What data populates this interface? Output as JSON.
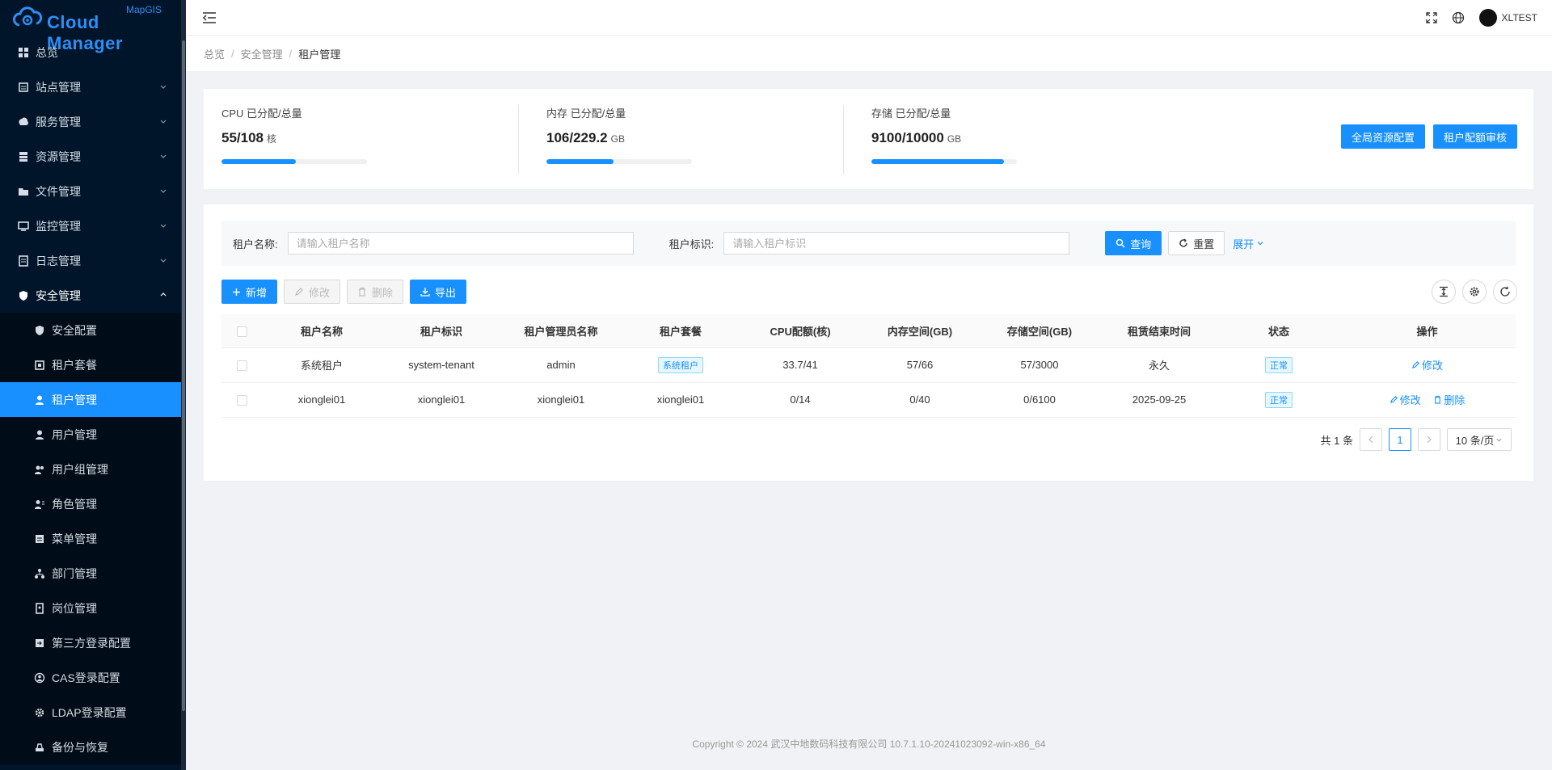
{
  "logo": {
    "small": "MapGIS",
    "big": "Cloud Manager"
  },
  "sidebar": {
    "items": [
      {
        "label": "总览",
        "icon": "dashboard-icon"
      },
      {
        "label": "站点管理",
        "icon": "site-icon"
      },
      {
        "label": "服务管理",
        "icon": "service-icon"
      },
      {
        "label": "资源管理",
        "icon": "resource-icon"
      },
      {
        "label": "文件管理",
        "icon": "folder-icon"
      },
      {
        "label": "监控管理",
        "icon": "monitor-icon"
      },
      {
        "label": "日志管理",
        "icon": "log-icon"
      },
      {
        "label": "安全管理",
        "icon": "shield-icon"
      }
    ],
    "sub_items": [
      {
        "label": "安全配置"
      },
      {
        "label": "租户套餐"
      },
      {
        "label": "租户管理"
      },
      {
        "label": "用户管理"
      },
      {
        "label": "用户组管理"
      },
      {
        "label": "角色管理"
      },
      {
        "label": "菜单管理"
      },
      {
        "label": "部门管理"
      },
      {
        "label": "岗位管理"
      },
      {
        "label": "第三方登录配置"
      },
      {
        "label": "CAS登录配置"
      },
      {
        "label": "LDAP登录配置"
      },
      {
        "label": "备份与恢复"
      }
    ]
  },
  "topbar": {
    "username": "XLTEST"
  },
  "breadcrumb": {
    "items": [
      "总览",
      "安全管理",
      "租户管理"
    ],
    "sep": "/"
  },
  "stats": [
    {
      "label": "CPU 已分配/总量",
      "value": "55/108",
      "unit": "核",
      "progress": 0.51
    },
    {
      "label": "内存 已分配/总量",
      "value": "106/229.2",
      "unit": "GB",
      "progress": 0.46
    },
    {
      "label": "存储 已分配/总量",
      "value": "9100/10000",
      "unit": "GB",
      "progress": 0.91
    }
  ],
  "stat_buttons": {
    "global": "全局资源配置",
    "quota": "租户配额审核"
  },
  "search": {
    "name_label": "租户名称:",
    "name_placeholder": "请输入租户名称",
    "id_label": "租户标识:",
    "id_placeholder": "请输入租户标识",
    "query": "查询",
    "reset": "重置",
    "expand": "展开"
  },
  "toolbar": {
    "add": "新增",
    "edit": "修改",
    "delete": "删除",
    "export": "导出"
  },
  "table": {
    "headers": [
      "租户名称",
      "租户标识",
      "租户管理员名称",
      "租户套餐",
      "CPU配额(核)",
      "内存空间(GB)",
      "存储空间(GB)",
      "租赁结束时间",
      "状态",
      "操作"
    ],
    "rows": [
      {
        "name": "系统租户",
        "id": "system-tenant",
        "admin": "admin",
        "package": "系统租户",
        "cpu": "33.7/41",
        "mem": "57/66",
        "storage": "57/3000",
        "end": "永久",
        "status": "正常",
        "edit": "修改"
      },
      {
        "name": "xionglei01",
        "id": "xionglei01",
        "admin": "xionglei01",
        "package": "xionglei01",
        "cpu": "0/14",
        "mem": "0/40",
        "storage": "0/6100",
        "end": "2025-09-25",
        "status": "正常",
        "edit": "修改",
        "delete": "删除"
      }
    ]
  },
  "pager": {
    "total": "共 1 条",
    "current": "1",
    "size": "10 条/页"
  },
  "footer": "Copyright © 2024 武汉中地数码科技有限公司 10.7.1.10-20241023092-win-x86_64",
  "colors": {
    "sidebar_bg": "#001529",
    "active": "#1890ff"
  }
}
